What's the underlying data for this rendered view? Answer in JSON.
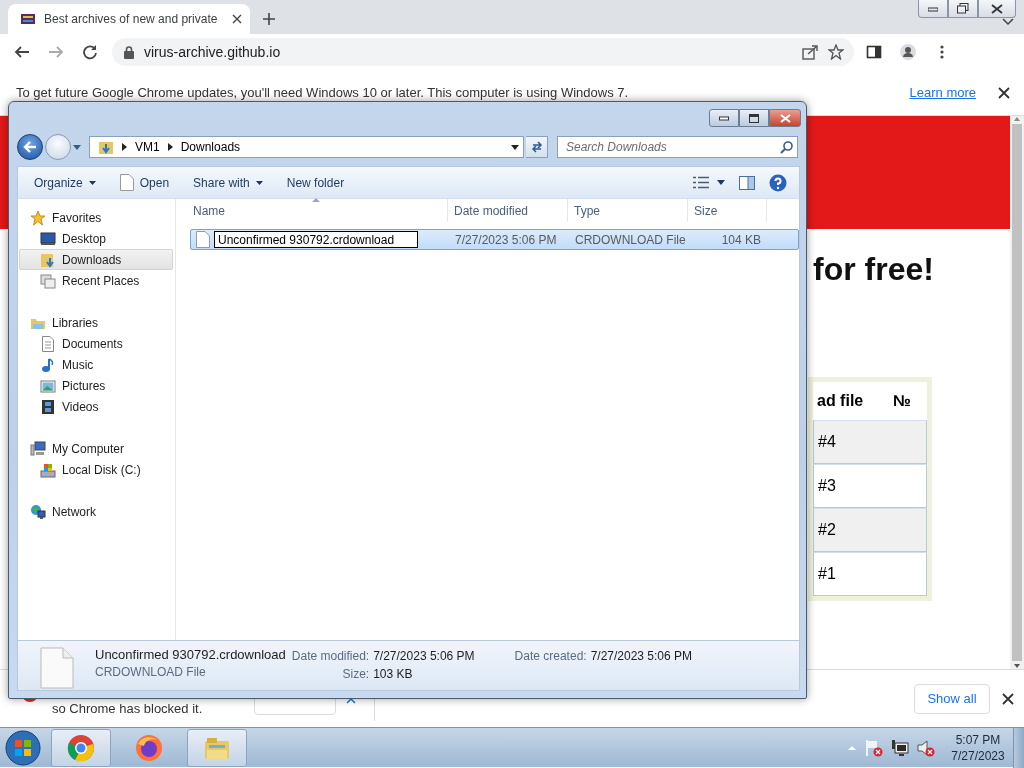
{
  "browser": {
    "tabs": [
      {
        "title": "Best archives of new and private",
        "selected": true
      }
    ],
    "address": "virus-archive.github.io"
  },
  "infobar": {
    "message": "To get future Google Chrome updates, you'll need Windows 10 or later. This computer is using Windows 7.",
    "link": "Learn more"
  },
  "page": {
    "heading": "for free!",
    "table": {
      "columns": [
        "ad file",
        "№"
      ],
      "rows": [
        {
          "number": "#4"
        },
        {
          "number": "#3"
        },
        {
          "number": "#2"
        },
        {
          "number": "#1"
        }
      ]
    }
  },
  "download_shelf": {
    "message": "so Chrome has blocked it.",
    "show_all": "Show all"
  },
  "explorer": {
    "breadcrumbs": [
      "VM1",
      "Downloads"
    ],
    "search": {
      "placeholder": "Search Downloads"
    },
    "toolbar": [
      {
        "label": "Organize",
        "kind": "menu"
      },
      {
        "label": "Open",
        "kind": "file"
      },
      {
        "label": "Share with",
        "kind": "menu"
      },
      {
        "label": "New folder",
        "kind": "plain"
      }
    ],
    "nav": [
      {
        "label": "Favorites",
        "kind": "star",
        "selected": false,
        "children": [
          {
            "label": "Desktop",
            "kind": "desktop",
            "selected": false
          },
          {
            "label": "Downloads",
            "kind": "downloads",
            "selected": true
          },
          {
            "label": "Recent Places",
            "kind": "recent",
            "selected": false
          }
        ]
      },
      {
        "label": "Libraries",
        "kind": "libraries",
        "selected": false,
        "children": [
          {
            "label": "Documents",
            "kind": "documents",
            "selected": false
          },
          {
            "label": "Music",
            "kind": "music",
            "selected": false
          },
          {
            "label": "Pictures",
            "kind": "pictures",
            "selected": false
          },
          {
            "label": "Videos",
            "kind": "videos",
            "selected": false
          }
        ]
      },
      {
        "label": "My Computer",
        "kind": "computer",
        "selected": false,
        "children": [
          {
            "label": "Local Disk (C:)",
            "kind": "disk",
            "selected": false
          }
        ]
      },
      {
        "label": "Network",
        "kind": "network",
        "selected": false
      }
    ],
    "columns": [
      "Name",
      "Date modified",
      "Type",
      "Size"
    ],
    "files": [
      {
        "name": "Unconfirmed 930792.crdownload",
        "date": "7/27/2023 5:06 PM",
        "type": "CRDOWNLOAD File",
        "size": "104 KB",
        "selected": true,
        "renaming": true
      }
    ],
    "details": {
      "name": "Unconfirmed 930792.crdownload",
      "type": "CRDOWNLOAD File",
      "columns": [
        [
          {
            "label": "Date modified:",
            "value": "7/27/2023 5:06 PM"
          },
          {
            "label": "Size:",
            "value": "103 KB"
          }
        ],
        [
          {
            "label": "Date created:",
            "value": "7/27/2023 5:06 PM"
          }
        ]
      ]
    }
  },
  "taskbar": {
    "apps": [
      {
        "kind": "chrome",
        "running": true
      },
      {
        "kind": "firefox",
        "running": false
      },
      {
        "kind": "explorer",
        "running": true
      }
    ],
    "time": "5:07 PM",
    "date": "7/27/2023"
  }
}
